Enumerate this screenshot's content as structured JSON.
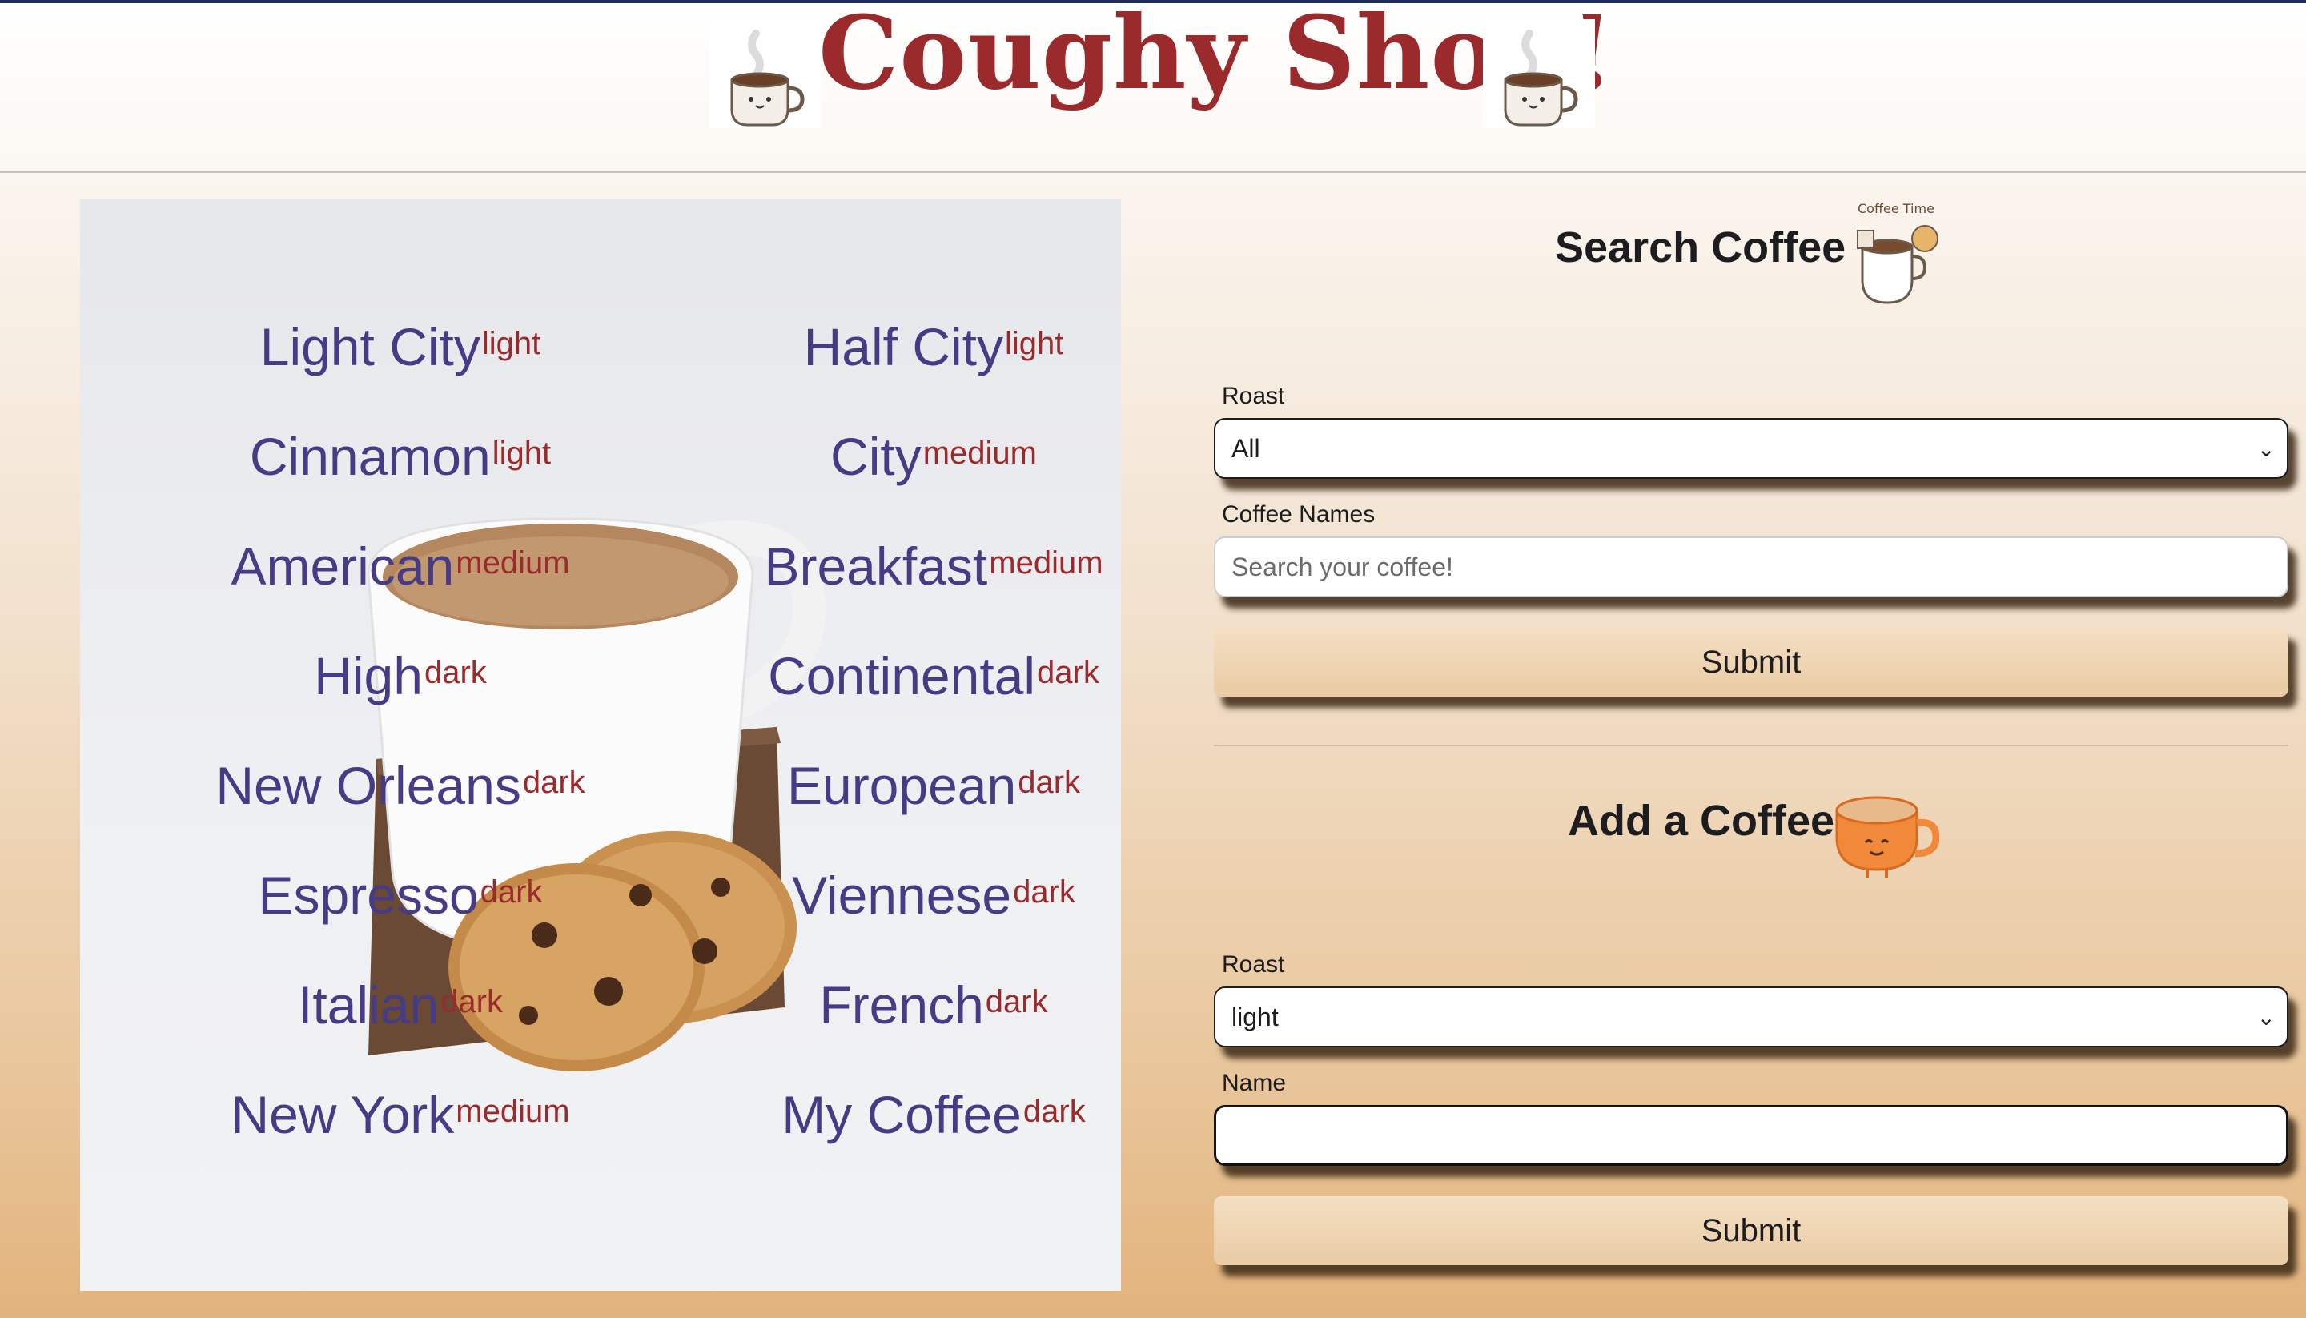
{
  "header": {
    "title": "Coughy Shop!"
  },
  "coffees": [
    {
      "name": "Light City",
      "roast": "light"
    },
    {
      "name": "Half City",
      "roast": "light"
    },
    {
      "name": "Cinnamon",
      "roast": "light"
    },
    {
      "name": "City",
      "roast": "medium"
    },
    {
      "name": "American",
      "roast": "medium"
    },
    {
      "name": "Breakfast",
      "roast": "medium"
    },
    {
      "name": "High",
      "roast": "dark"
    },
    {
      "name": "Continental",
      "roast": "dark"
    },
    {
      "name": "New Orleans",
      "roast": "dark"
    },
    {
      "name": "European",
      "roast": "dark"
    },
    {
      "name": "Espresso",
      "roast": "dark"
    },
    {
      "name": "Viennese",
      "roast": "dark"
    },
    {
      "name": "Italian",
      "roast": "dark"
    },
    {
      "name": "French",
      "roast": "dark"
    },
    {
      "name": "New York",
      "roast": "medium"
    },
    {
      "name": "My Coffee",
      "roast": "dark"
    }
  ],
  "search": {
    "title": "Search Coffee",
    "badge_text": "Coffee Time",
    "roast_label": "Roast",
    "roast_value": "All",
    "names_label": "Coffee Names",
    "names_placeholder": "Search your coffee!",
    "submit_label": "Submit"
  },
  "add": {
    "title": "Add a Coffee",
    "roast_label": "Roast",
    "roast_value": "light",
    "name_label": "Name",
    "name_value": "",
    "submit_label": "Submit"
  },
  "colors": {
    "title_red": "#9b2a2d",
    "coffee_purple": "#463b85",
    "roast_red": "#9b2a2d"
  }
}
